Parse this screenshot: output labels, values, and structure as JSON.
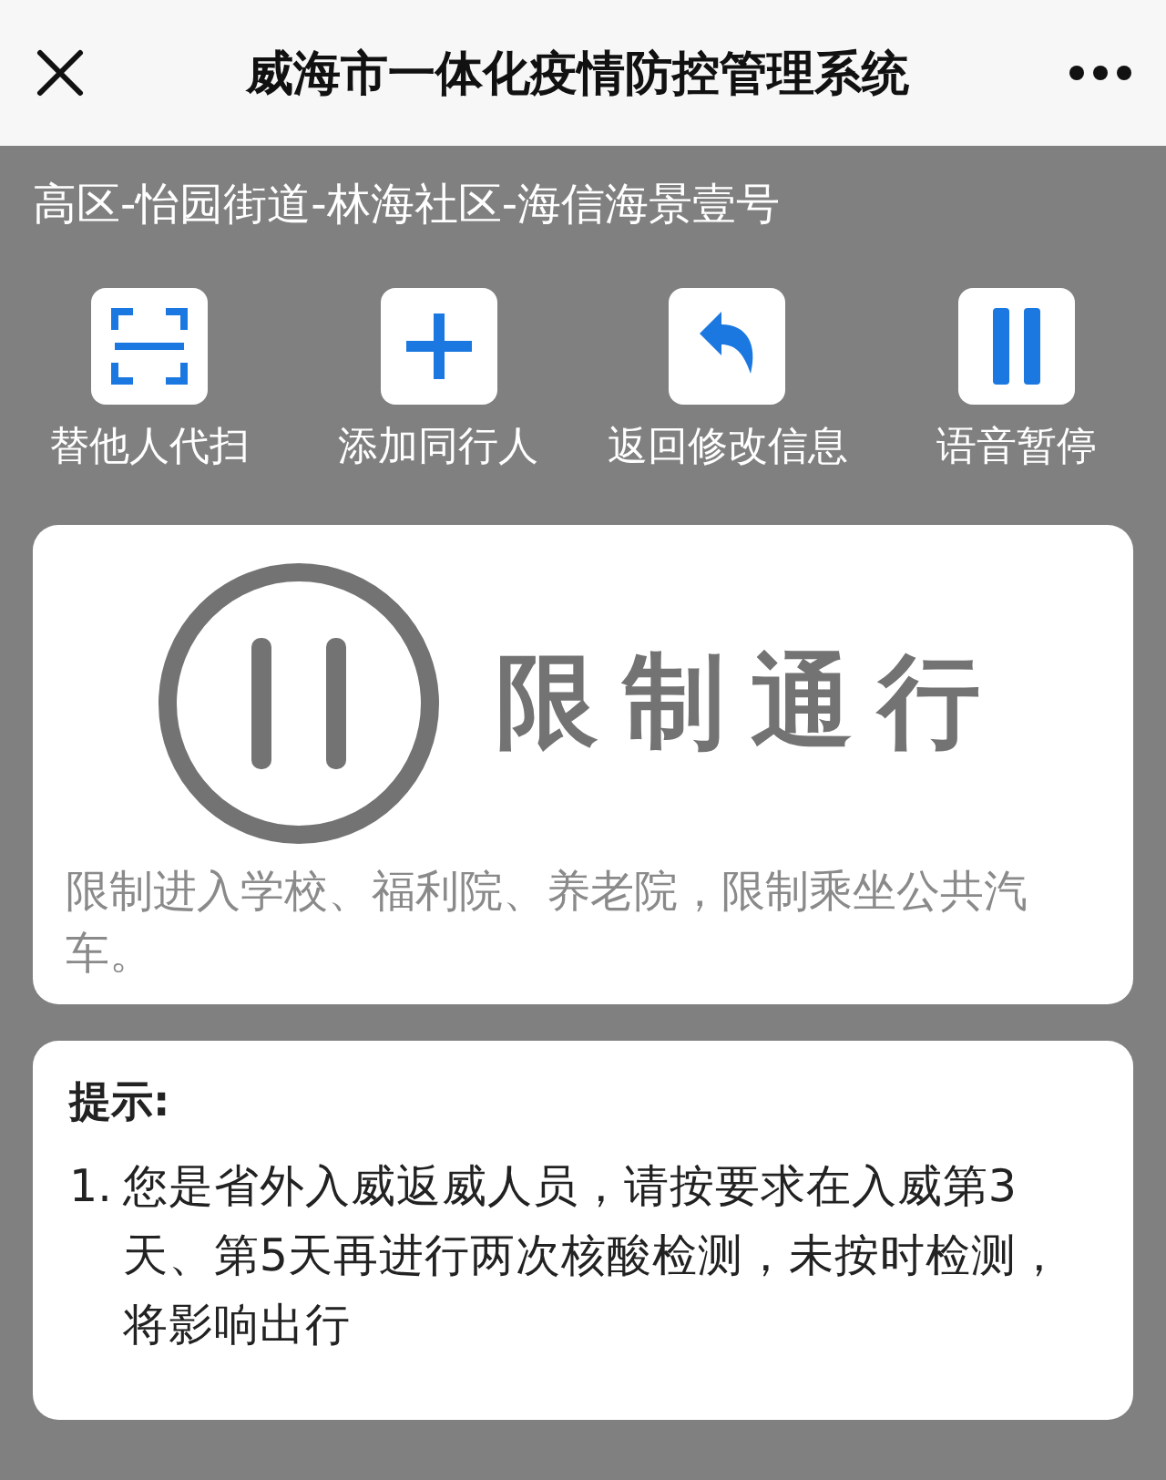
{
  "header": {
    "title": "威海市一体化疫情防控管理系统"
  },
  "location": "高区-怡园街道-林海社区-海信海景壹号",
  "actions": [
    {
      "kind": "scan",
      "label": "替他人代扫"
    },
    {
      "kind": "add",
      "label": "添加同行人"
    },
    {
      "kind": "back",
      "label": "返回修改信息"
    },
    {
      "kind": "pause",
      "label": "语音暂停"
    }
  ],
  "status": {
    "kind": "restricted",
    "title": "限制通行",
    "description": "限制进入学校、福利院、养老院，限制乘坐公共汽车。"
  },
  "tips": {
    "heading": "提示:",
    "items": [
      {
        "number": "1.",
        "text": "您是省外入威返威人员，请按要求在入威第3天、第5天再进行两次核酸检测，未按时检测，将影响出行"
      }
    ]
  }
}
